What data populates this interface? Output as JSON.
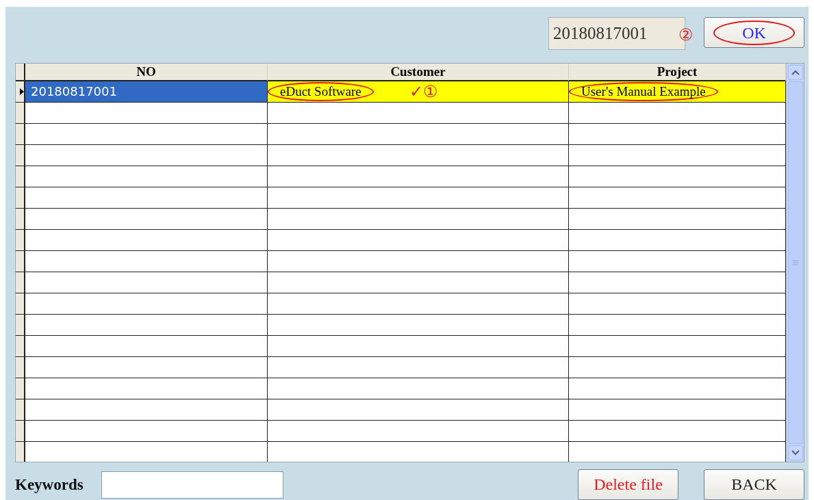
{
  "current_no": {
    "value": "20180817001",
    "note": "②"
  },
  "ok_button": {
    "label": "OK",
    "circled": true
  },
  "table": {
    "columns": [
      "NO",
      "Customer",
      "Project"
    ],
    "rows": [
      {
        "selected": true,
        "cells": [
          {
            "text": "20180817001",
            "circled": false
          },
          {
            "text": "eDuct Software",
            "circled": true,
            "note": "✓①"
          },
          {
            "text": "User's Manual Example",
            "circled": true
          }
        ]
      }
    ]
  },
  "keywords": {
    "label": "Keywords"
  },
  "buttons": [
    {
      "label": "Delete file",
      "kind": "danger"
    },
    {
      "label": "BACK",
      "kind": "normal"
    }
  ]
}
